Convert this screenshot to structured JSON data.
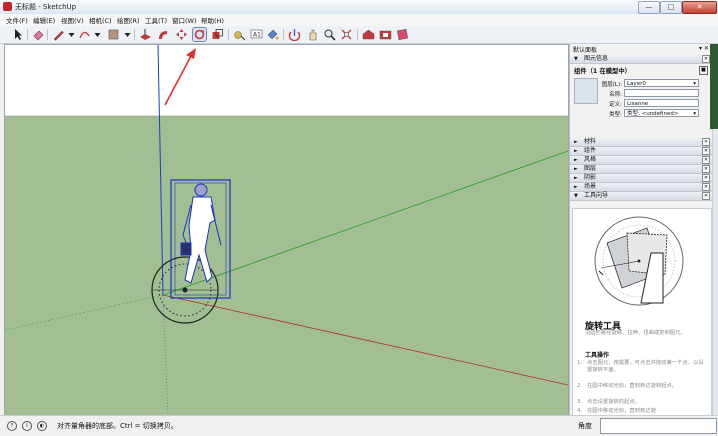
{
  "window": {
    "title": "无标题 - SketchUp",
    "minimize_label": "—",
    "maximize_label": "□",
    "close_label": "✕"
  },
  "menu": [
    "文件(F)",
    "编辑(E)",
    "视图(V)",
    "相机(C)",
    "绘图(R)",
    "工具(T)",
    "窗口(W)",
    "帮助(H)"
  ],
  "toolbar": {
    "icons": [
      "select-icon",
      "eraser-icon",
      "line-pencil-icon",
      "line-dropdown-icon",
      "arc-icon",
      "arc-dropdown-icon",
      "shape-icon",
      "shape-dropdown-icon",
      "push-pull-icon",
      "follow-me-icon",
      "move-icon",
      "rotate-icon",
      "scale-icon",
      "tape-measure-icon",
      "text-icon",
      "paint-bucket-icon",
      "orbit-icon",
      "pan-icon",
      "zoom-icon",
      "zoom-extents-icon",
      "warehouse-icon",
      "extension-warehouse-icon",
      "layout-icon"
    ],
    "active": "rotate-icon"
  },
  "tray": {
    "title": "默认面板",
    "entity_info": {
      "section": "图元信息",
      "heading": "组件（1 在模型中）",
      "layer_label": "图层(L):",
      "layer_value": "Layer0",
      "name_label": "名称:",
      "name_value": "",
      "definition_label": "定义:",
      "definition_value": "Lisanne",
      "type_label": "类型:",
      "type_value": "类型: <undefined>"
    },
    "sections": [
      "材料",
      "组件",
      "风格",
      "图层",
      "阴影",
      "场景",
      "工具向导"
    ],
    "instructor": {
      "tool_name": "旋转工具",
      "description": "沿圆形路径旋转、拉伸、扭曲或复制图元。",
      "ops_title": "工具操作",
      "steps": [
        "点击图元，按需要，可点击并拖动第一个点，以设置旋转平面。",
        "在圆中移动光标，直到到达旋转起点。",
        "点击设置旋转的起点。",
        "在圆中移动光标，直到到达旋"
      ]
    }
  },
  "status": {
    "message": "对齐量角器的底部。Ctrl = 切换拷贝。",
    "measure_label": "角度",
    "measure_value": ""
  },
  "colors": {
    "ground": "#a2bf93",
    "sky": "#ffffff",
    "axis_blue": "#1d3bd6",
    "axis_green": "#1f9a1f",
    "axis_red": "#b03030",
    "selection": "#1f2fc8",
    "arrow": "#e03030"
  }
}
